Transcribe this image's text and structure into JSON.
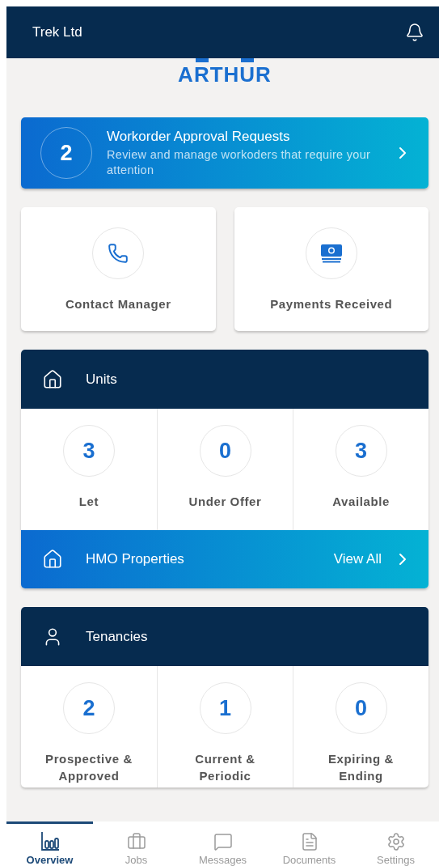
{
  "header": {
    "title": "Trek Ltd"
  },
  "logo": {
    "text": "ARTHUR"
  },
  "approval_banner": {
    "count": "2",
    "title": "Workorder Approval Requests",
    "description": "Review and manage workoders that require your attention"
  },
  "quick_actions": [
    {
      "kind": "phone",
      "label": "Contact Manager"
    },
    {
      "kind": "money",
      "label": "Payments Received"
    }
  ],
  "units": {
    "title": "Units",
    "stats": [
      {
        "value": "3",
        "label": "Let"
      },
      {
        "value": "0",
        "label": "Under Offer"
      },
      {
        "value": "3",
        "label": "Available"
      }
    ],
    "link_bar": {
      "title": "HMO Properties",
      "action": "View All"
    }
  },
  "tenancies": {
    "title": "Tenancies",
    "stats": [
      {
        "value": "2",
        "label": "Prospective &\nApproved"
      },
      {
        "value": "1",
        "label": "Current &\nPeriodic"
      },
      {
        "value": "0",
        "label": "Expiring &\nEnding"
      }
    ]
  },
  "bottom_nav": [
    {
      "kind": "overview",
      "label": "Overview",
      "selected": true
    },
    {
      "kind": "jobs",
      "label": "Jobs",
      "selected": false
    },
    {
      "kind": "messages",
      "label": "Messages",
      "selected": false
    },
    {
      "kind": "documents",
      "label": "Documents",
      "selected": false
    },
    {
      "kind": "settings",
      "label": "Settings",
      "selected": false
    }
  ]
}
